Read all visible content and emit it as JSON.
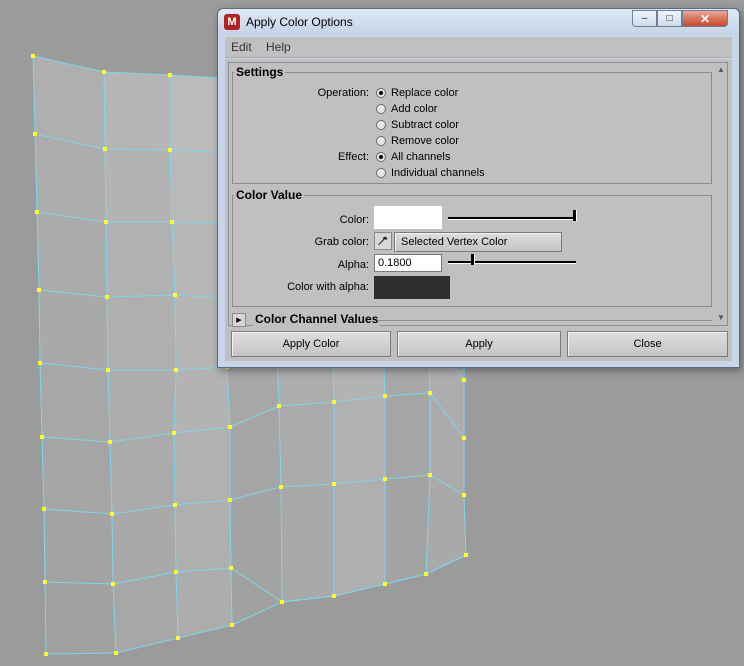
{
  "window": {
    "title": "Apply Color Options",
    "app_icon": "maya-app-icon",
    "controls": {
      "minimize": "minimize-icon",
      "maximize": "maximize-icon",
      "close": "close-icon"
    }
  },
  "menu": {
    "items": [
      "Edit",
      "Help"
    ]
  },
  "settings": {
    "title": "Settings",
    "operation_label": "Operation:",
    "operations": [
      {
        "label": "Replace color",
        "selected": true
      },
      {
        "label": "Add color",
        "selected": false
      },
      {
        "label": "Subtract color",
        "selected": false
      },
      {
        "label": "Remove color",
        "selected": false
      }
    ],
    "effect_label": "Effect:",
    "effects": [
      {
        "label": "All channels",
        "selected": true
      },
      {
        "label": "Individual channels",
        "selected": false
      }
    ]
  },
  "color_value": {
    "title": "Color Value",
    "color_label": "Color:",
    "color_swatch": "#ffffff",
    "color_slider_value": 1.0,
    "grab_color_label": "Grab color:",
    "grab_color_button": "Selected Vertex Color",
    "alpha_label": "Alpha:",
    "alpha_value": "0.1800",
    "alpha_slider_value": 0.18,
    "color_with_alpha_label": "Color with alpha:",
    "color_with_alpha_swatch": "#2e2e2e"
  },
  "channel_values": {
    "title": "Color Channel Values"
  },
  "buttons": {
    "apply_close": "Apply Color",
    "apply": "Apply",
    "close": "Close"
  },
  "viewport": {
    "mesh_edge_color": "#7ed6ee",
    "vertex_color": "#ffff22",
    "surface_color": "#b4b4b4"
  }
}
